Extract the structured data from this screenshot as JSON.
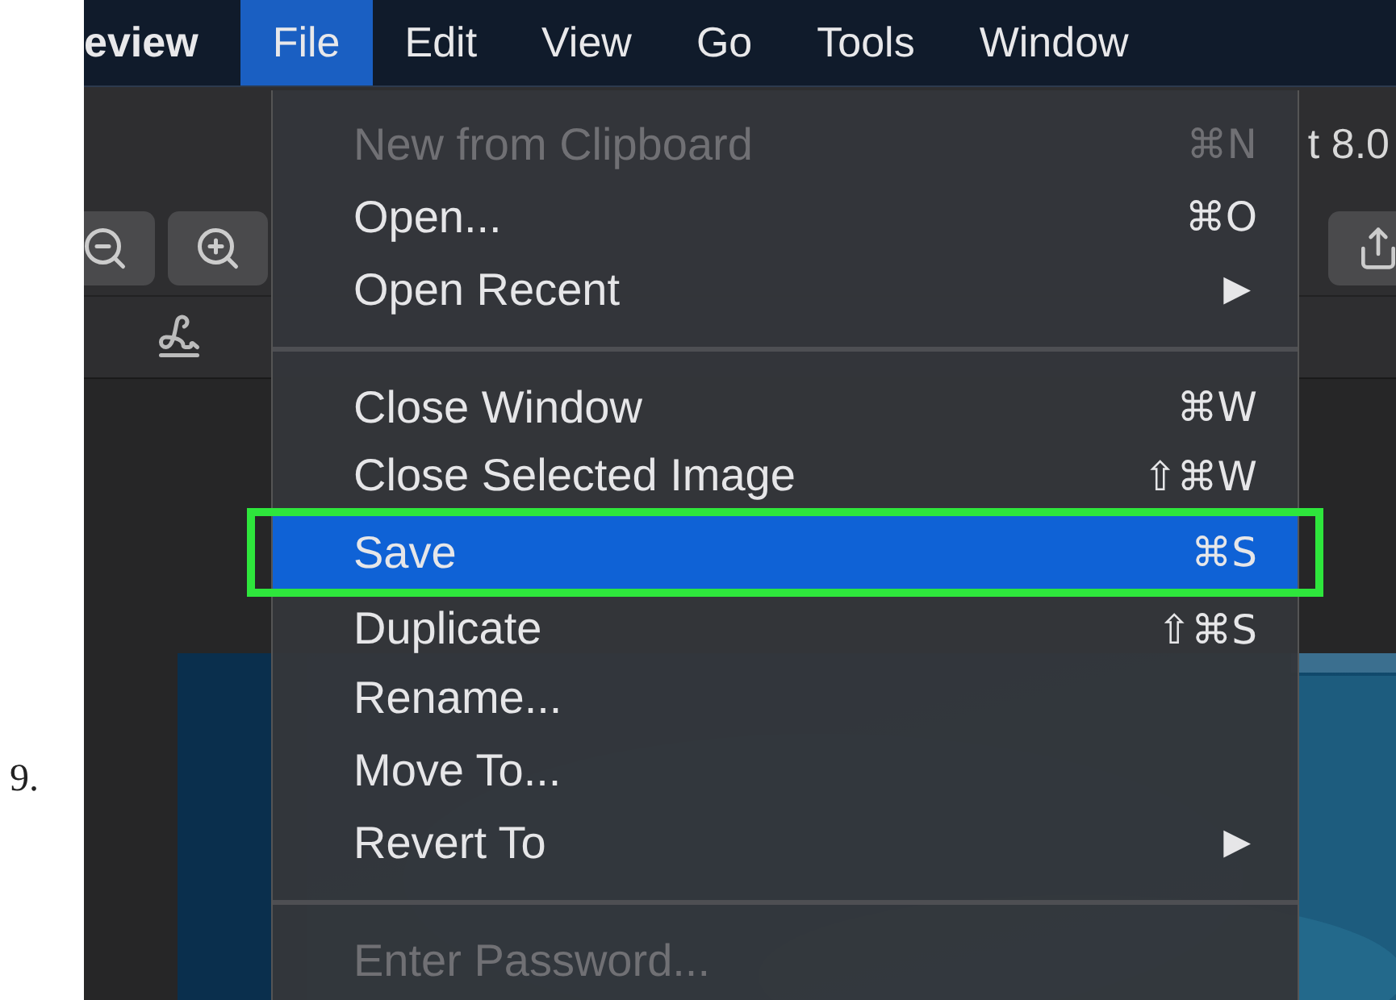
{
  "step_number": "9.",
  "menu_bar": [
    {
      "label": "eview",
      "kind": "app",
      "selected": false
    },
    {
      "label": "File",
      "kind": "menu",
      "selected": true
    },
    {
      "label": "Edit",
      "kind": "menu",
      "selected": false
    },
    {
      "label": "View",
      "kind": "menu",
      "selected": false
    },
    {
      "label": "Go",
      "kind": "menu",
      "selected": false
    },
    {
      "label": "Tools",
      "kind": "menu",
      "selected": false
    },
    {
      "label": "Window",
      "kind": "menu",
      "selected": false
    }
  ],
  "window": {
    "title": "t 8.0"
  },
  "file_menu": [
    {
      "kind": "item",
      "label": "New from Clipboard",
      "shortcut": "⌘N",
      "disabled": true,
      "selected": false,
      "outlined": false
    },
    {
      "kind": "item",
      "label": "Open...",
      "shortcut": "⌘O",
      "disabled": false,
      "selected": false,
      "outlined": false
    },
    {
      "kind": "submenu",
      "label": "Open Recent",
      "shortcut": "▶",
      "disabled": false,
      "selected": false,
      "outlined": false
    },
    {
      "kind": "separator"
    },
    {
      "kind": "item",
      "label": "Close Window",
      "shortcut": "⌘W",
      "disabled": false,
      "selected": false,
      "outlined": false
    },
    {
      "kind": "item",
      "label": "Close Selected Image",
      "shortcut": "⇧⌘W",
      "disabled": false,
      "selected": false,
      "outlined": false
    },
    {
      "kind": "item",
      "label": "Save",
      "shortcut": "⌘S",
      "disabled": false,
      "selected": true,
      "outlined": true
    },
    {
      "kind": "item",
      "label": "Duplicate",
      "shortcut": "⇧⌘S",
      "disabled": false,
      "selected": false,
      "outlined": false
    },
    {
      "kind": "item",
      "label": "Rename...",
      "disabled": false,
      "selected": false,
      "outlined": false
    },
    {
      "kind": "item",
      "label": "Move To...",
      "disabled": false,
      "selected": false,
      "outlined": false
    },
    {
      "kind": "submenu",
      "label": "Revert To",
      "shortcut": "▶",
      "disabled": false,
      "selected": false,
      "outlined": false
    },
    {
      "kind": "separator"
    },
    {
      "kind": "item",
      "label": "Enter Password...",
      "disabled": true,
      "selected": false,
      "outlined": false
    }
  ]
}
